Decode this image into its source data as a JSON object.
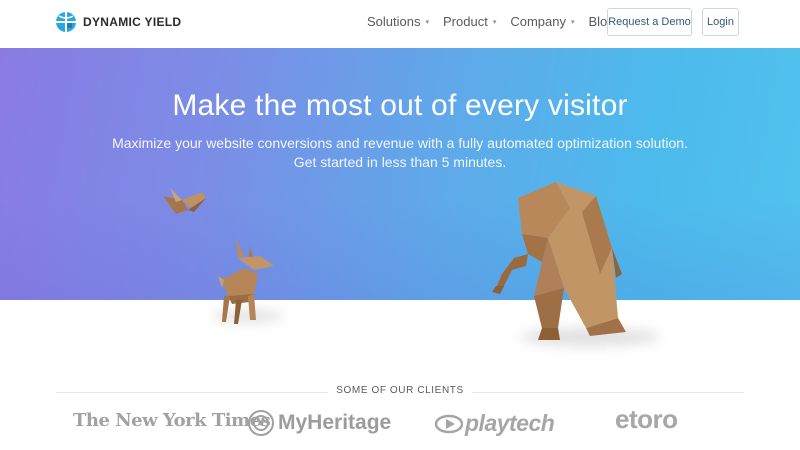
{
  "brand": {
    "name": "DYNAMIC YIELD",
    "logo_color": "#2aa7df"
  },
  "nav": {
    "items": [
      {
        "label": "Solutions",
        "has_dropdown": true
      },
      {
        "label": "Product",
        "has_dropdown": true
      },
      {
        "label": "Company",
        "has_dropdown": true
      },
      {
        "label": "Blog",
        "has_dropdown": false
      }
    ],
    "chevron": "⌄"
  },
  "actions": {
    "demo_label": "Request a Demo",
    "login_label": "Login"
  },
  "hero": {
    "title": "Make the most out of every visitor",
    "subtitle_line1": "Maximize your website conversions and revenue with a fully automated optimization solution.",
    "subtitle_line2": "Get started in less than 5 minutes."
  },
  "clients": {
    "title": "SOME OF OUR CLIENTS",
    "logos": [
      "The New York Times",
      "MyHeritage",
      "playtech",
      "etoro"
    ]
  },
  "colors": {
    "hero_gradient_start": "#8a7be3",
    "hero_gradient_end": "#52c2ee",
    "button_text": "#2f5b78",
    "origami_paper": "#b8875a"
  }
}
